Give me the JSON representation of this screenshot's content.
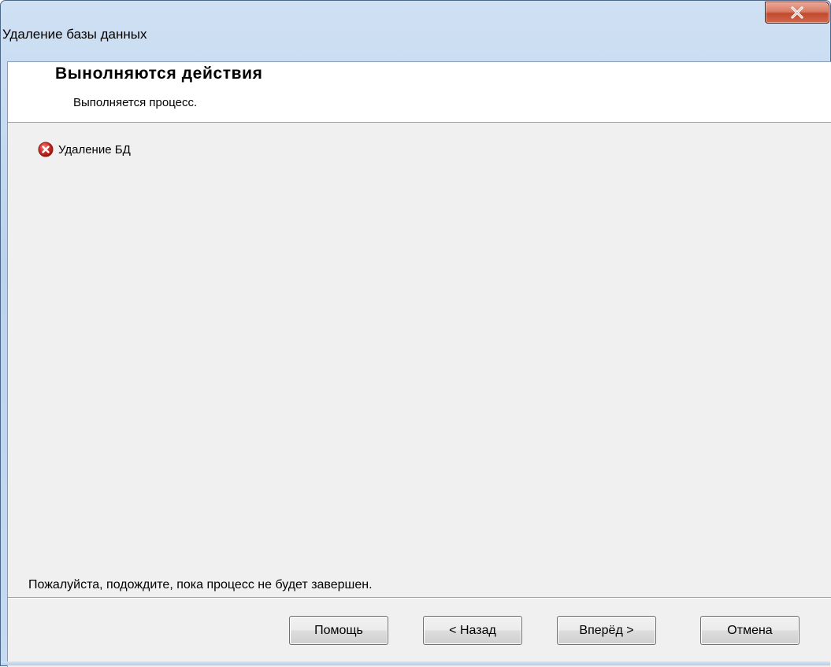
{
  "window": {
    "title": "Удаление базы данных",
    "close_symbol": "X"
  },
  "header": {
    "title": "Вынолняются действия",
    "subtitle": "Выполняется процесс."
  },
  "tasks": [
    {
      "label": "Удаление БД",
      "status_icon": "error-icon"
    }
  ],
  "status_message": "Пожалуйста, подождите, пока процесс не будет завершен.",
  "buttons": {
    "help": "Помощь",
    "back": "< Назад",
    "next": "Вперёд >",
    "cancel": "Отмена"
  },
  "colors": {
    "close_button": "#c24a2e",
    "error_icon": "#d0302a",
    "dialog_background": "#f0f0f0"
  }
}
